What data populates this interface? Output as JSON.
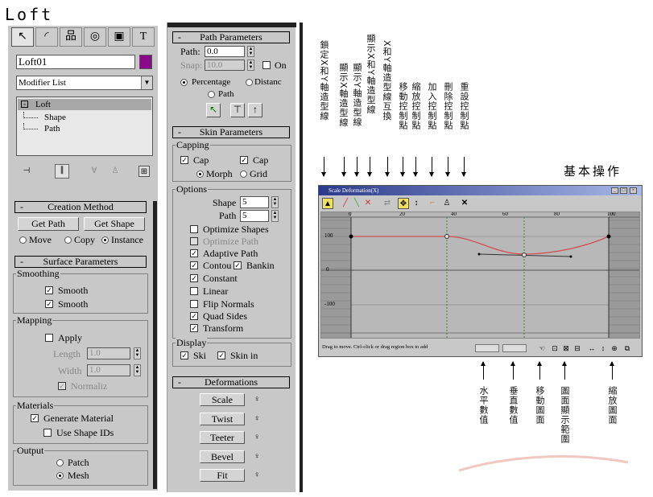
{
  "title": "Loft",
  "left_panel": {
    "name_field": "Loft01",
    "name_color": "#8b0a8b",
    "modifier_list": "Modifier List",
    "stack": [
      "Loft",
      "Shape",
      "Path"
    ],
    "creation_method": {
      "header": "Creation Method",
      "get_path": "Get Path",
      "get_shape": "Get Shape",
      "move": "Move",
      "copy": "Copy",
      "instance": "Instance"
    },
    "surface_parameters": {
      "header": "Surface Parameters",
      "smoothing": "Smoothing",
      "smooth1": "Smooth",
      "smooth2": "Smooth",
      "mapping": "Mapping",
      "apply": "Apply",
      "length_label": "Length",
      "length_value": "1.0",
      "width_label": "Width",
      "width_value": "1.0",
      "normalize": "Normaliz",
      "materials": "Materials",
      "generate_material": "Generate Material",
      "use_shape_ids": "Use Shape IDs",
      "output": "Output",
      "patch": "Patch",
      "mesh": "Mesh"
    }
  },
  "middle_panel": {
    "path_parameters": {
      "header": "Path Parameters",
      "path_label": "Path:",
      "path_value": "0.0",
      "snap_label": "Snap:",
      "snap_value": "10.0",
      "on_label": "On",
      "percentage": "Percentage",
      "distance": "Distanc",
      "path_steps": "Path"
    },
    "skin_parameters": {
      "header": "Skin Parameters",
      "capping": "Capping",
      "cap_start": "Cap",
      "cap_end": "Cap",
      "morph": "Morph",
      "grid": "Grid",
      "options": "Options",
      "shape_label": "Shape",
      "shape_value": "5",
      "path_label": "Path",
      "path_value": "5",
      "optimize_shapes": "Optimize Shapes",
      "optimize_path": "Optimize Path",
      "adaptive_path": "Adaptive Path",
      "contour": "Contou",
      "banking": "Bankin",
      "constant": "Constant",
      "linear": "Linear",
      "flip_normals": "Flip Normals",
      "quad_sides": "Quad Sides",
      "transform": "Transform",
      "display": "Display",
      "skin": "Ski",
      "skin_in": "Skin in"
    },
    "deformations": {
      "header": "Deformations",
      "buttons": [
        "Scale",
        "Twist",
        "Teeter",
        "Bevel",
        "Fit"
      ]
    }
  },
  "annotations": {
    "top": [
      "鎖定X和Y軸造型線",
      "顯示X軸造型線",
      "顯示Y軸造型線",
      "顯示X和Y軸造型線",
      "X和Y軸造型線互換",
      "移動控制點",
      "縮放控制點",
      "加入控制點",
      "刪除控制點",
      "重設控制點"
    ],
    "basic_ops": "基本操作",
    "bottom": [
      "水平數值",
      "垂直數值",
      "移動圖面",
      "圖面顯示範圍",
      "縮放圖面"
    ]
  },
  "scale_window": {
    "title": "Scale Deformation(X)",
    "x_ticks": [
      "0",
      "20",
      "40",
      "60",
      "80",
      "100"
    ],
    "y_ticks": [
      "100",
      "0",
      "-100"
    ],
    "status": "Drag to move. Ctrl-click or drag region box to add"
  }
}
